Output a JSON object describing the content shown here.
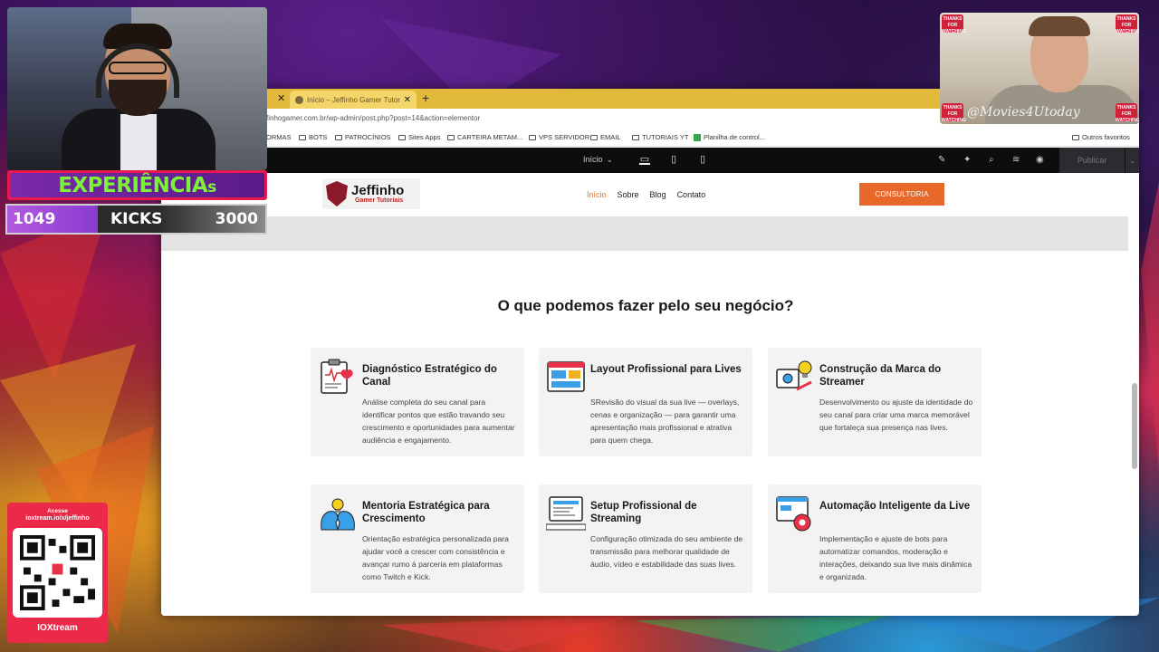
{
  "browser": {
    "tab_title": "Início – Jeffinho Gamer Tutoriais",
    "url": "finhogamer.com.br/wp-admin/post.php?post=14&action=elementor",
    "bookmarks": [
      "ORMAS",
      "BOTS",
      "PATROCÍNIOS",
      "Sites Apps",
      "CARTEIRA METAM...",
      "VPS SERVIDOR",
      "EMAIL",
      "TUTORIAIS YT",
      "Planilha de control...",
      "Outros favoritos"
    ]
  },
  "elementor": {
    "page_selector": "Início",
    "publish_label": "Publicar"
  },
  "site": {
    "logo_line1": "Jeffinho",
    "logo_line2": "Gamer Tutoriais",
    "nav": [
      "Início",
      "Sobre",
      "Blog",
      "Contato"
    ],
    "cta_label": "CONSULTORIA",
    "section_title": "O que podemos fazer pelo seu negócio?",
    "cards": [
      {
        "icon": "clipboard-heart-icon",
        "title": "Diagnóstico Estratégico do Canal",
        "desc": "Análise completa do seu canal para identificar pontos que estão travando seu crescimento e oportunidades para aumentar audiência e engajamento."
      },
      {
        "icon": "layout-window-icon",
        "title": "Layout Profissional para Lives",
        "desc": "SRevisão do visual da sua live — overlays, cenas e organização — para garantir uma apresentação mais profissional e atrativa para quem chega."
      },
      {
        "icon": "brand-idea-icon",
        "title": "Construção da Marca do Streamer",
        "desc": "Desenvolvimento ou ajuste da identidade do seu canal para criar uma marca memorável que fortaleça sua presença nas lives."
      },
      {
        "icon": "mentoring-heads-icon",
        "title": "Mentoria Estratégica para Crescimento",
        "desc": "Orientação estratégica personalizada para ajudar você a crescer com consistência e avançar rumo à parceria em plataformas como Twitch e Kick."
      },
      {
        "icon": "streaming-setup-icon",
        "title": "Setup Profissional de Streaming",
        "desc": "Configuração otimizada do seu ambiente de transmissão para melhorar qualidade de áudio, vídeo e estabilidade das suas lives."
      },
      {
        "icon": "automation-gear-icon",
        "title": "Automação Inteligente da Live",
        "desc": "Implementação e ajuste de bots para automatizar comandos, moderação e interações, deixando sua live mais dinâmica e organizada."
      }
    ]
  },
  "overlay": {
    "xp_label": "EXPERIÊNCIA",
    "xp_suffix": "s",
    "progress_value": "1049",
    "progress_label": "KICKS",
    "progress_max": "3000",
    "progress_fraction": 0.35,
    "qr_line1": "Acesse",
    "qr_line2": "ioxtream.io/x/jeffinho",
    "brand": "IOXtream",
    "watermark": "@Movies4Utoday",
    "badge_text": "THANKS FOR WATCHING"
  },
  "colors": {
    "accent": "#e8682a",
    "tabbar": "#e2b93b",
    "overlay_red": "#e8194d",
    "xp_green": "#7cf23a"
  }
}
